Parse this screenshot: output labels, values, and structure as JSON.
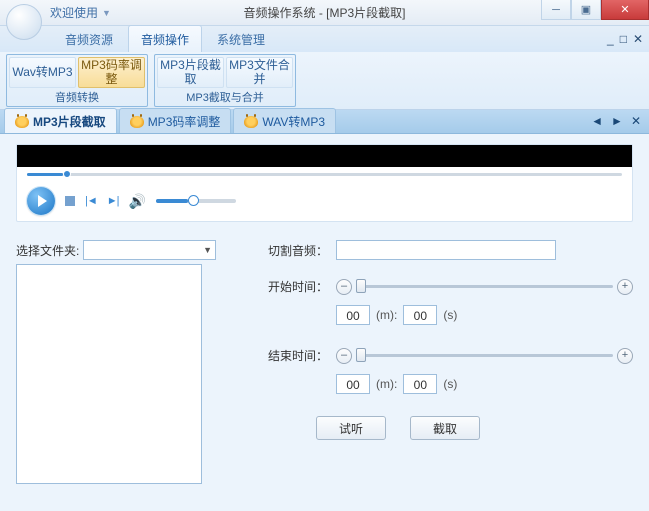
{
  "titlebar": {
    "welcome": "欢迎使用",
    "app_title": "音频操作系统 - [MP3片段截取]",
    "min": "─",
    "max": "▣",
    "close": "✕"
  },
  "menu": {
    "tabs": [
      "音频资源",
      "音频操作",
      "系统管理"
    ],
    "active_index": 1,
    "mini": {
      "min": "_",
      "restore": "□",
      "close": "✕"
    }
  },
  "ribbon": {
    "groups": [
      {
        "label": "音频转换",
        "buttons": [
          {
            "label": "Wav转MP3",
            "active": false
          },
          {
            "label": "MP3码率调整",
            "active": true
          }
        ]
      },
      {
        "label": "MP3截取与合并",
        "buttons": [
          {
            "label": "MP3片段截取",
            "active": false
          },
          {
            "label": "MP3文件合并",
            "active": false
          }
        ]
      }
    ]
  },
  "doc_tabs": {
    "items": [
      "MP3片段截取",
      "MP3码率调整",
      "WAV转MP3"
    ],
    "active_index": 0,
    "ctrl": {
      "prev": "◄",
      "next": "►",
      "close": "✕"
    }
  },
  "form": {
    "folder_label": "选择文件夹:",
    "cut_label": "切割音频：",
    "start_label": "开始时间：",
    "end_label": "结束时间：",
    "minus": "–",
    "plus": "+",
    "mm": "00",
    "m_unit": "(m):",
    "ss": "00",
    "s_unit": "(s)",
    "preview_btn": "试听",
    "cut_btn": "截取"
  }
}
